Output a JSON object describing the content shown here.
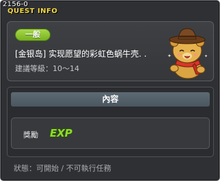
{
  "window": {
    "corner_id": "2156-0",
    "title": "QUEST INFO"
  },
  "quest": {
    "category": "一般",
    "name": "[金银岛] 实现愿望的彩虹色蜗牛壳. .",
    "level": "建議等級：10～14",
    "npc_icon": "bear-hat-npc-icon"
  },
  "content": {
    "header": "內容",
    "reward_label": "獎勵",
    "reward_item": "EXP",
    "reward_icon": "exp-icon"
  },
  "status": {
    "text": "狀態：可開始 / 不可執行任務"
  },
  "colors": {
    "window_bg": "#2f3033",
    "title": "#f0d640",
    "category_pill": "#8cc63a",
    "header_bar": "#55616b",
    "exp_green": "#7fd321"
  }
}
